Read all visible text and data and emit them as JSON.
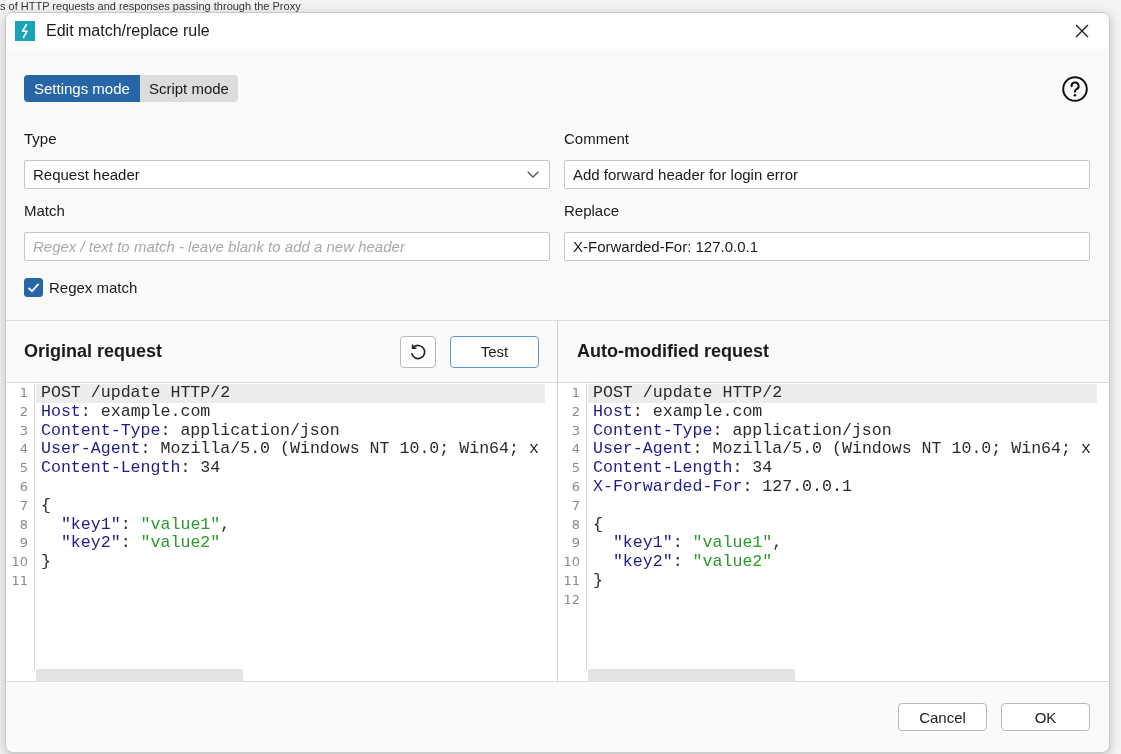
{
  "background_window": {
    "text": "s of HTTP requests and responses passing through the Proxy"
  },
  "dialog": {
    "title": "Edit match/replace rule"
  },
  "mode_tabs": [
    {
      "label": "Settings mode",
      "selected": true
    },
    {
      "label": "Script mode",
      "selected": false
    }
  ],
  "fields": [
    {
      "kind": "select",
      "label": "Type",
      "value": "Request header"
    },
    {
      "kind": "text",
      "label": "Comment",
      "value": "Add forward header for login error"
    },
    {
      "kind": "text",
      "label": "Match",
      "placeholder": "Regex / text to match - leave blank to add a new header"
    },
    {
      "kind": "text",
      "label": "Replace",
      "value": "X-Forwarded-For: 127.0.0.1"
    }
  ],
  "regex_match": {
    "label": "Regex match",
    "checked": true
  },
  "panels": [
    {
      "title": "Original request",
      "actions": [
        {
          "kind": "reset",
          "focused": false
        },
        {
          "kind": "test",
          "label": "Test",
          "focused": true
        }
      ],
      "lines": [
        {
          "number": "1",
          "selected": true,
          "tokens": [
            {
              "kind": "plain",
              "text": "POST /update HTTP/2"
            }
          ]
        },
        {
          "number": "2",
          "selected": false,
          "tokens": [
            {
              "kind": "name",
              "text": "Host"
            },
            {
              "kind": "plain",
              "text": ": example.com"
            }
          ]
        },
        {
          "number": "3",
          "selected": false,
          "tokens": [
            {
              "kind": "name",
              "text": "Content-Type"
            },
            {
              "kind": "plain",
              "text": ": application/json"
            }
          ]
        },
        {
          "number": "4",
          "selected": false,
          "tokens": [
            {
              "kind": "name",
              "text": "User-Agent"
            },
            {
              "kind": "plain",
              "text": ": Mozilla/5.0 (Windows NT 10.0; Win64; x"
            }
          ]
        },
        {
          "number": "5",
          "selected": false,
          "tokens": [
            {
              "kind": "name",
              "text": "Content-Length"
            },
            {
              "kind": "plain",
              "text": ": 34"
            }
          ]
        },
        {
          "number": "6",
          "selected": false
        },
        {
          "number": "7",
          "selected": false,
          "tokens": [
            {
              "kind": "plain",
              "text": "{"
            }
          ]
        },
        {
          "number": "8",
          "selected": false,
          "tokens": [
            {
              "kind": "key",
              "text": "  \"key1\""
            },
            {
              "kind": "plain",
              "text": ": "
            },
            {
              "kind": "string",
              "text": "\"value1\""
            },
            {
              "kind": "plain",
              "text": ","
            }
          ]
        },
        {
          "number": "9",
          "selected": false,
          "tokens": [
            {
              "kind": "key",
              "text": "  \"key2\""
            },
            {
              "kind": "plain",
              "text": ": "
            },
            {
              "kind": "string",
              "text": "\"value2\""
            }
          ]
        },
        {
          "number": "10",
          "selected": false,
          "tokens": [
            {
              "kind": "plain",
              "text": "}"
            }
          ]
        },
        {
          "number": "11",
          "selected": false
        }
      ]
    },
    {
      "title": "Auto-modified request",
      "lines": [
        {
          "number": "1",
          "selected": true,
          "tokens": [
            {
              "kind": "plain",
              "text": "POST /update HTTP/2"
            }
          ]
        },
        {
          "number": "2",
          "selected": false,
          "tokens": [
            {
              "kind": "name",
              "text": "Host"
            },
            {
              "kind": "plain",
              "text": ": example.com"
            }
          ]
        },
        {
          "number": "3",
          "selected": false,
          "tokens": [
            {
              "kind": "name",
              "text": "Content-Type"
            },
            {
              "kind": "plain",
              "text": ": application/json"
            }
          ]
        },
        {
          "number": "4",
          "selected": false,
          "tokens": [
            {
              "kind": "name",
              "text": "User-Agent"
            },
            {
              "kind": "plain",
              "text": ": Mozilla/5.0 (Windows NT 10.0; Win64; x"
            }
          ]
        },
        {
          "number": "5",
          "selected": false,
          "tokens": [
            {
              "kind": "name",
              "text": "Content-Length"
            },
            {
              "kind": "plain",
              "text": ": 34"
            }
          ]
        },
        {
          "number": "6",
          "selected": false,
          "tokens": [
            {
              "kind": "name",
              "text": "X-Forwarded-For"
            },
            {
              "kind": "plain",
              "text": ": 127.0.0.1"
            }
          ]
        },
        {
          "number": "7",
          "selected": false
        },
        {
          "number": "8",
          "selected": false,
          "tokens": [
            {
              "kind": "plain",
              "text": "{"
            }
          ]
        },
        {
          "number": "9",
          "selected": false,
          "tokens": [
            {
              "kind": "key",
              "text": "  \"key1\""
            },
            {
              "kind": "plain",
              "text": ": "
            },
            {
              "kind": "string",
              "text": "\"value1\""
            },
            {
              "kind": "plain",
              "text": ","
            }
          ]
        },
        {
          "number": "10",
          "selected": false,
          "tokens": [
            {
              "kind": "key",
              "text": "  \"key2\""
            },
            {
              "kind": "plain",
              "text": ": "
            },
            {
              "kind": "string",
              "text": "\"value2\""
            }
          ]
        },
        {
          "number": "11",
          "selected": false,
          "tokens": [
            {
              "kind": "plain",
              "text": "}"
            }
          ]
        },
        {
          "number": "12",
          "selected": false
        }
      ]
    }
  ],
  "footer_buttons": [
    {
      "label": "Cancel",
      "focused": false
    },
    {
      "label": "OK",
      "focused": false
    }
  ]
}
